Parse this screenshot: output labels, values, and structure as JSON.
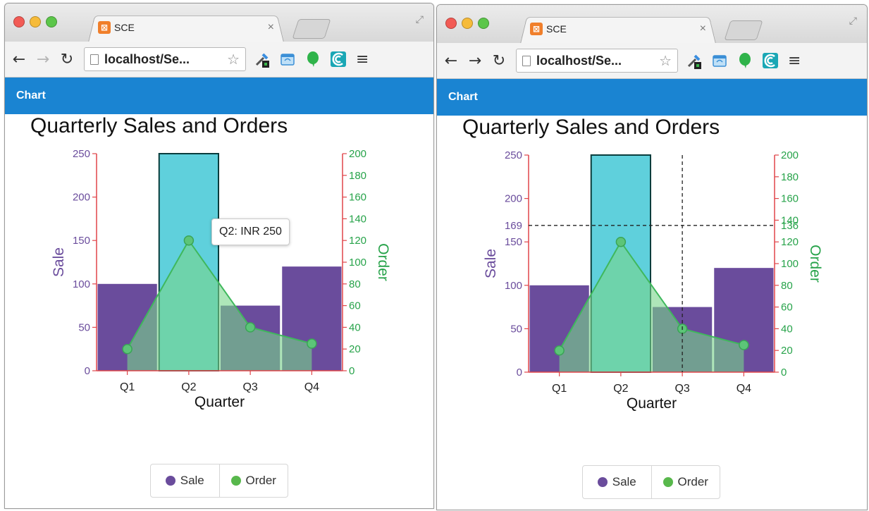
{
  "windows": [
    {
      "id": "left",
      "tab": {
        "title": "SCE",
        "close": "×",
        "favicon": "sce-favicon-icon"
      },
      "toolbar": {
        "url": "localhost/Se...",
        "back_enabled": true,
        "forward_enabled": false
      },
      "app_bar": {
        "title": "Chart"
      },
      "tooltip": {
        "text": "Q2: INR 250"
      },
      "crosshair": null
    },
    {
      "id": "right",
      "tab": {
        "title": "SCE",
        "close": "×",
        "favicon": "sce-favicon-icon"
      },
      "toolbar": {
        "url": "localhost/Se...",
        "back_enabled": true,
        "forward_enabled": true
      },
      "app_bar": {
        "title": "Chart"
      },
      "tooltip": null,
      "crosshair": {
        "y_left_label": "169",
        "y_right_label": "136",
        "x_position_category": "Q3"
      }
    }
  ],
  "chart_data": {
    "type": "bar",
    "title": "Quarterly Sales and Orders",
    "xlabel": "Quarter",
    "ylabel": "Sale",
    "y2label": "Order",
    "categories": [
      "Q1",
      "Q2",
      "Q3",
      "Q4"
    ],
    "ylim": [
      0,
      250
    ],
    "y2lim": [
      0,
      200
    ],
    "yticks": [
      0,
      50,
      100,
      150,
      200,
      250
    ],
    "y2ticks": [
      0,
      20,
      40,
      60,
      80,
      100,
      120,
      140,
      160,
      180,
      200
    ],
    "series": [
      {
        "name": "Sale",
        "type": "bar",
        "axis": "left",
        "values": [
          100,
          250,
          75,
          120
        ],
        "color": "#6a4c9c"
      },
      {
        "name": "Order",
        "type": "area",
        "axis": "right",
        "values": [
          20,
          120,
          40,
          25
        ],
        "color": "#4cbb6c"
      }
    ],
    "highlight_category": "Q2",
    "highlight_color": "#5fd0dc",
    "legend": [
      {
        "name": "Sale",
        "color": "#6a4c9c"
      },
      {
        "name": "Order",
        "color": "#58b84c"
      }
    ],
    "axis_colors": {
      "left_axis_line": "#e0454a",
      "left_ticks_text": "#6a4c9c",
      "right_ticks_text": "#27a34a"
    }
  }
}
